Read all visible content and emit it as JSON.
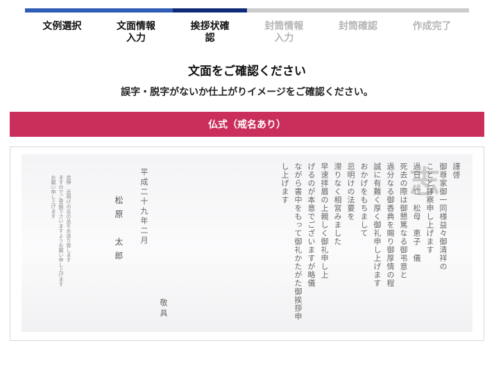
{
  "colors": {
    "progress_done": "#2f5cb5",
    "progress_current": "#0f2a78",
    "progress_todo": "#cccccc",
    "banner": "#c92f5a"
  },
  "progress": {
    "completed_steps": 3,
    "total_steps": 6
  },
  "steps": [
    {
      "lines": [
        "文例選択"
      ],
      "state": "done"
    },
    {
      "lines": [
        "文面情報",
        "入力"
      ],
      "state": "done"
    },
    {
      "lines": [
        "挨拶状確",
        "認"
      ],
      "state": "current"
    },
    {
      "lines": [
        "封筒情報",
        "入力"
      ],
      "state": "todo"
    },
    {
      "lines": [
        "封筒確認"
      ],
      "state": "todo"
    },
    {
      "lines": [
        "作成完了"
      ],
      "state": "todo"
    }
  ],
  "heading": "文面をご確認ください",
  "subheading": "誤字・脱字がないか仕上がりイメージをご確認ください。",
  "banner_label": "仏式（戒名あり）",
  "preview": {
    "watermark": "志",
    "letter_columns": [
      "謹啓",
      "御尊家御一同様益々御清祥の",
      "ことと拝察申し上げます",
      "過日　亡　松母　恵子　儀",
      "死去の際は御懇篤なる御弔意と",
      "過分なる御香典を賜り御厚情の程",
      "誠に有難く厚く御礼申し上げます",
      "おかげをもちまして",
      "忌明けの法要を",
      "滞りなく相営みました",
      "早速拝眉の上親しく御礼申し上",
      "げるのが本意でございますが略儀",
      "ながら書中をもって御礼かたがた御挨拶申",
      "し上げます"
    ],
    "letter_closing": "敬具",
    "date": "平成二十九年二月",
    "signer": "松原　太郎",
    "note_columns": [
      "追伸　忌明けの志の品をお送り致します",
      "ますのでご受納下さいますようお願い申し上げます",
      "お願い申し上げます"
    ]
  }
}
